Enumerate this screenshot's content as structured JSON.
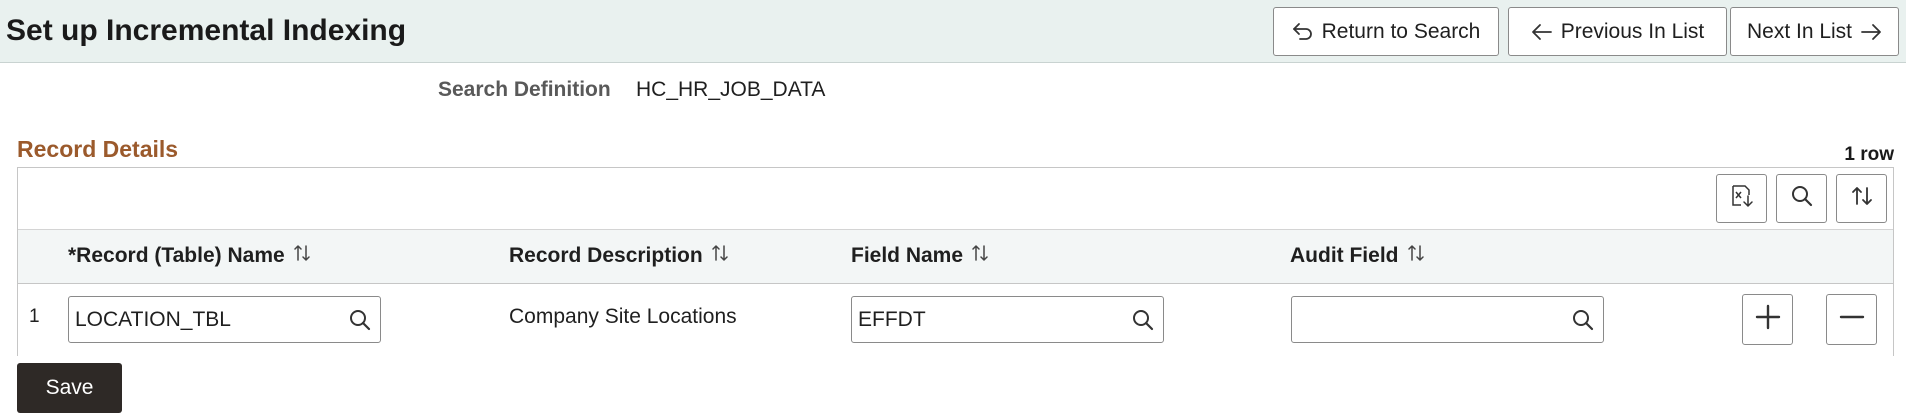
{
  "header": {
    "title": "Set up Incremental Indexing",
    "return_label": "Return to Search",
    "prev_label": "Previous In List",
    "next_label": "Next In List"
  },
  "search_definition": {
    "label": "Search Definition",
    "value": "HC_HR_JOB_DATA"
  },
  "record_details": {
    "title": "Record Details",
    "row_count": "1 row",
    "columns": [
      {
        "label": "*Record (Table) Name"
      },
      {
        "label": "Record Description"
      },
      {
        "label": "Field Name"
      },
      {
        "label": "Audit Field"
      }
    ],
    "rows": [
      {
        "number": "1",
        "record_name": "LOCATION_TBL",
        "record_description": "Company Site Locations",
        "field_name": "EFFDT",
        "audit_field": ""
      }
    ]
  },
  "icons": {
    "return": "return-arrow-icon",
    "prev": "arrow-left-icon",
    "next": "arrow-right-icon",
    "export": "export-excel-icon",
    "find": "search-icon",
    "sort": "sort-icon",
    "lookup": "search-icon",
    "add": "plus-icon",
    "delete": "minus-icon"
  },
  "footer": {
    "save_label": "Save"
  },
  "colors": {
    "header_bg": "#e9f1ef",
    "section_title": "#9b5a2c",
    "save_bg": "#2e2926"
  }
}
